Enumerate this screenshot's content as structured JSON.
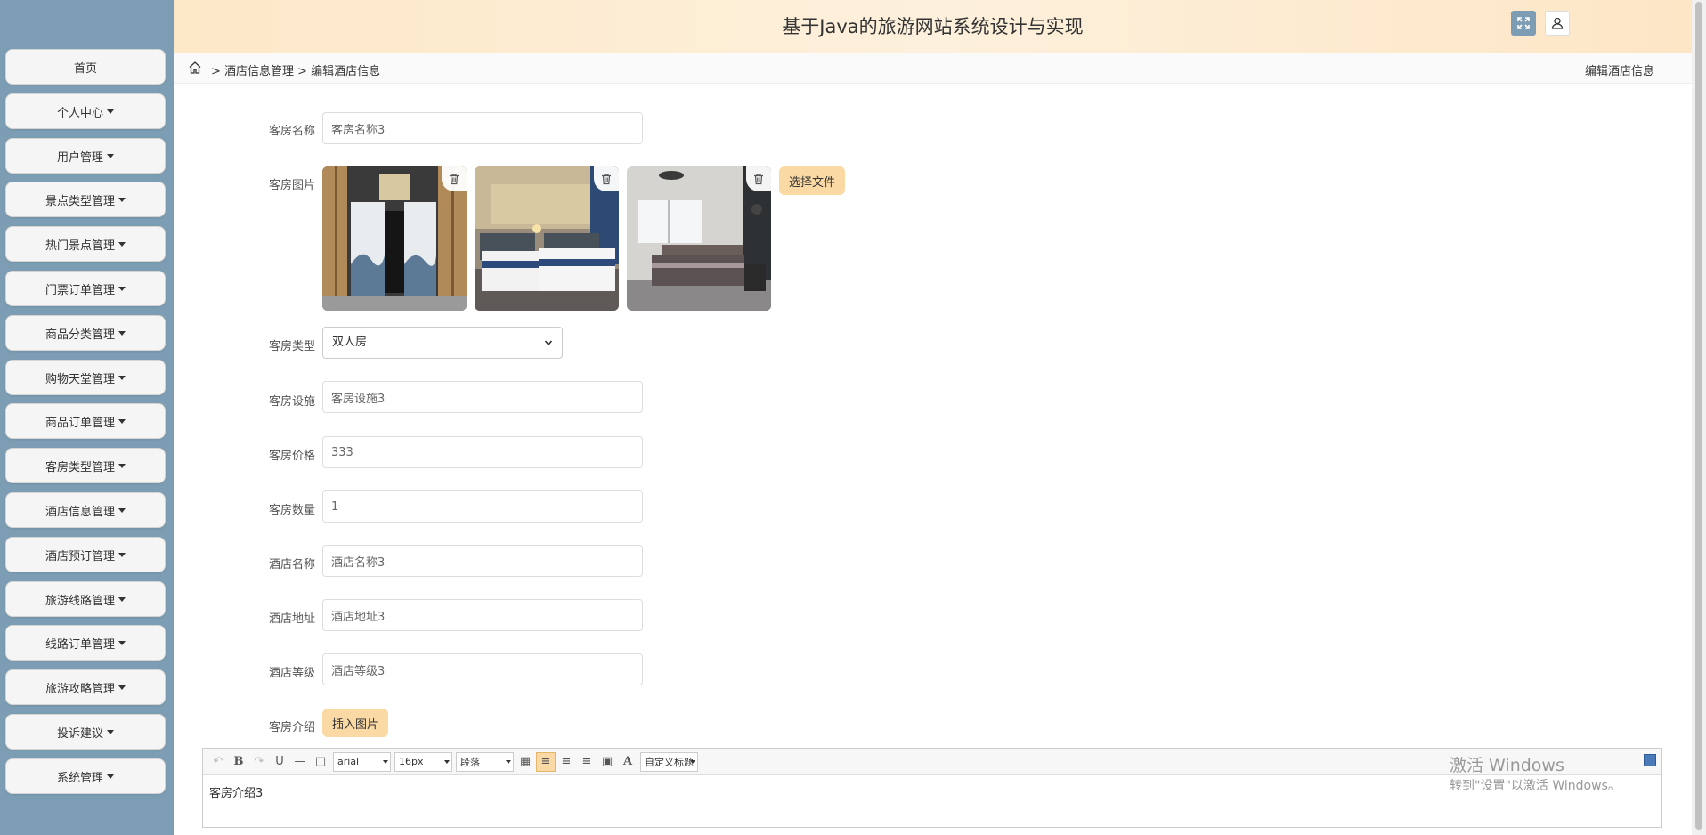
{
  "header": {
    "title": "基于Java的旅游网站系统设计与实现"
  },
  "breadcrumb": {
    "path": "> 酒店信息管理 > 编辑酒店信息",
    "current": "编辑酒店信息"
  },
  "sidebar": {
    "items": [
      {
        "label": "首页"
      },
      {
        "label": "个人中心"
      },
      {
        "label": "用户管理"
      },
      {
        "label": "景点类型管理"
      },
      {
        "label": "热门景点管理"
      },
      {
        "label": "门票订单管理"
      },
      {
        "label": "商品分类管理"
      },
      {
        "label": "购物天堂管理"
      },
      {
        "label": "商品订单管理"
      },
      {
        "label": "客房类型管理"
      },
      {
        "label": "酒店信息管理"
      },
      {
        "label": "酒店预订管理"
      },
      {
        "label": "旅游线路管理"
      },
      {
        "label": "线路订单管理"
      },
      {
        "label": "旅游攻略管理"
      },
      {
        "label": "投诉建议"
      },
      {
        "label": "系统管理"
      }
    ]
  },
  "form": {
    "room_name": {
      "label": "客房名称",
      "value": "客房名称3"
    },
    "room_image": {
      "label": "客房图片",
      "choose_file": "选择文件"
    },
    "room_type": {
      "label": "客房类型",
      "value": "双人房"
    },
    "facilities": {
      "label": "客房设施",
      "value": "客房设施3"
    },
    "price": {
      "label": "客房价格",
      "value": "333"
    },
    "quantity": {
      "label": "客房数量",
      "value": "1"
    },
    "hotel_name": {
      "label": "酒店名称",
      "value": "酒店名称3"
    },
    "hotel_address": {
      "label": "酒店地址",
      "value": "酒店地址3"
    },
    "hotel_grade": {
      "label": "酒店等级",
      "value": "酒店等级3"
    },
    "description": {
      "label": "客房介绍",
      "insert_image": "插入图片"
    }
  },
  "editor": {
    "font": "arial",
    "size": "16px",
    "block": "段落",
    "custom": "自定义标题",
    "content": "客房介绍3"
  },
  "watermark": {
    "line1": "激活 Windows",
    "line2": "转到\"设置\"以激活 Windows。"
  }
}
